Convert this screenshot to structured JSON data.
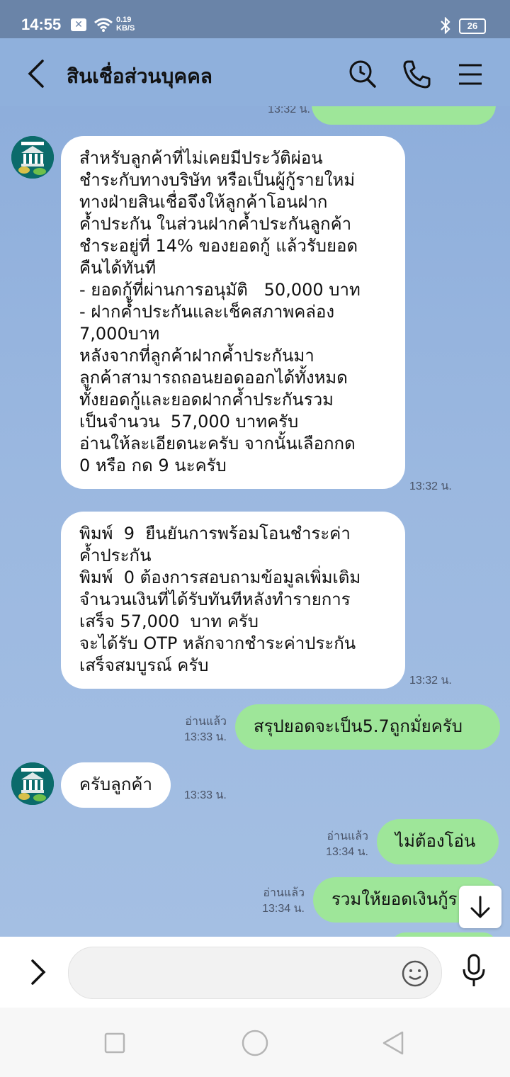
{
  "status_bar": {
    "time": "14:55",
    "net_speed_value": "0.19",
    "net_speed_unit": "KB/S",
    "battery": "26"
  },
  "header": {
    "title": "สินเชื่อส่วนบุคคล"
  },
  "partial_top": {
    "timestamp": "13:32 น."
  },
  "messages": [
    {
      "id": "m1",
      "direction": "in",
      "text": "สำหรับลูกค้าที่ไม่เคยมีประวัติผ่อน\nชำระกับทางบริษัท หรือเป็นผู้กู้รายใหม่\nทางฝ่ายสินเชื่อจึงให้ลูกค้าโอนฝาก\nค้ำประกัน ในส่วนฝากค้ำประกันลูกค้า\nชำระอยู่ที่ 14% ของยอดกู้ แล้วรับยอด\nคืนได้ทันที\n- ยอดกู้ที่ผ่านการอนุมัติ   50,000 บาท\n- ฝากค้ำประกันและเช็คสภาพคล่อง\n7,000บาท\nหลังจากที่ลูกค้าฝากค้ำประกันมา\nลูกค้าสามารถถอนยอดออกได้ทั้งหมด\nทั้งยอดกู้และยอดฝากค้ำประกันรวม\nเป็นจำนวน  57,000 บาทครับ\nอ่านให้ละเอียดนะครับ จากนั้นเลือกกด\n0 หรือ กด 9 นะครับ",
      "time": "13:32 น."
    },
    {
      "id": "m2",
      "direction": "in",
      "text": "พิมพ์  9  ยืนยันการพร้อมโอนชำระค่า\nค้ำประกัน\nพิมพ์  0 ต้องการสอบถามข้อมูลเพิ่มเติม\nจำนวนเงินที่ได้รับทันทีหลังทำรายการ\nเสร็จ 57,000  บาท ครับ\nจะได้รับ OTP หลักจากชำระค่าประกัน\nเสร็จสมบูรณ์ ครับ",
      "time": "13:32 น."
    },
    {
      "id": "m3",
      "direction": "out",
      "text": "สรุปยอดจะเป็น5.7ถูกมั่ยครับ",
      "read": "อ่านแล้ว",
      "time": "13:33 น."
    },
    {
      "id": "m4",
      "direction": "in",
      "text": "ครับลูกค้า",
      "time": "13:33 น."
    },
    {
      "id": "m5",
      "direction": "out",
      "text": "ไม่ต้องโอ่น",
      "read": "อ่านแล้ว",
      "time": "13:34 น."
    },
    {
      "id": "m6",
      "direction": "out",
      "text": "รวมให้ยอดเงินกู้ร",
      "read": "อ่านแล้ว",
      "time": "13:34 น."
    }
  ],
  "colors": {
    "chat_background": "#8fb0dc",
    "incoming_bubble": "#ffffff",
    "outgoing_bubble": "#9ee699",
    "status_bar": "#6a84a8"
  },
  "icons": {
    "header": [
      "back-arrow-icon",
      "search-history-icon",
      "phone-icon",
      "menu-icon"
    ],
    "input": [
      "chevron-right-icon",
      "emoji-icon",
      "microphone-icon"
    ],
    "scroll": "arrow-down-icon",
    "nav": [
      "square-icon",
      "circle-icon",
      "triangle-back-icon"
    ]
  }
}
